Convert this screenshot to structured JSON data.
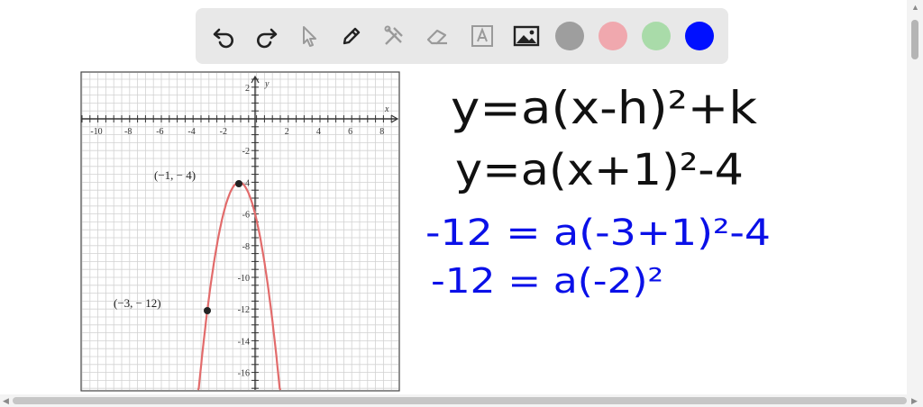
{
  "toolbar": {
    "tools": [
      {
        "name": "undo-icon"
      },
      {
        "name": "redo-icon"
      },
      {
        "name": "select-icon"
      },
      {
        "name": "pen-icon"
      },
      {
        "name": "tools-icon"
      },
      {
        "name": "eraser-icon"
      },
      {
        "name": "text-icon"
      },
      {
        "name": "image-icon"
      }
    ],
    "colors": [
      "#9e9e9e",
      "#f0a8ae",
      "#a9dba9",
      "#0010ff"
    ]
  },
  "graph": {
    "x_axis_label": "x",
    "y_axis_label": "y",
    "x_ticks": [
      "-10",
      "-8",
      "-6",
      "-4",
      "-2",
      "2",
      "4",
      "6",
      "8"
    ],
    "y_ticks": [
      "2",
      "-2",
      "-4",
      "-6",
      "-8",
      "-10",
      "-12",
      "-14",
      "-16"
    ],
    "vertex_label": "(−1, − 4)",
    "point_label": "(−3, − 12)",
    "curve_color": "#e26b6b"
  },
  "handwriting": {
    "line1": "y=a(x-h)²+k",
    "line2": "y=a(x+1)²-4",
    "line3": "-12 = a(-3+1)²-4",
    "line4": "-12 = a(-2)²"
  }
}
